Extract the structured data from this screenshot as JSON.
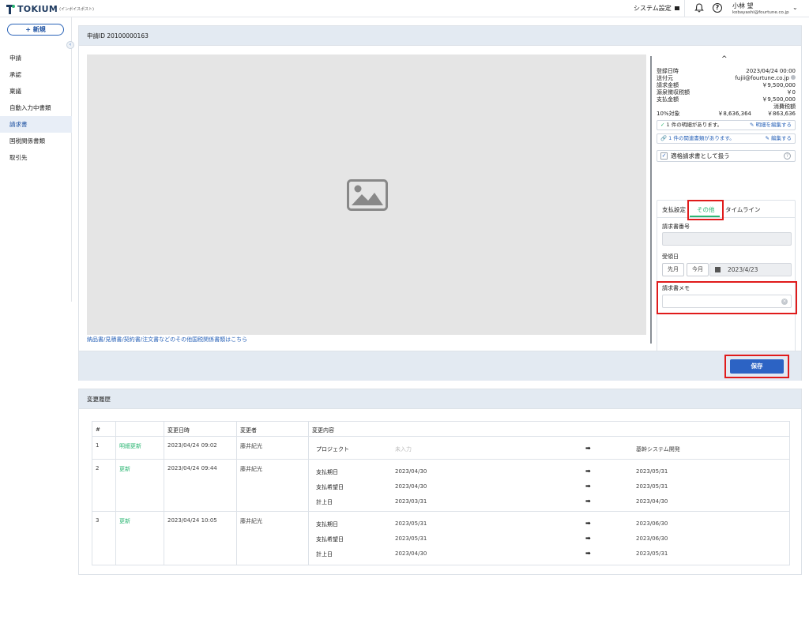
{
  "header": {
    "logo_text": "TOKIUM",
    "logo_sub": "(インボイスポスト)",
    "system_settings": "システム設定",
    "help_glyph": "?",
    "user_name": "小林 望",
    "user_email": "kobayashi@fourtune.co.jp",
    "user_caret": "⌄"
  },
  "sidebar": {
    "new_button": "+ 新規",
    "collapse_glyph": "‹",
    "items": [
      {
        "label": "申請",
        "active": false
      },
      {
        "label": "承認",
        "active": false
      },
      {
        "label": "稟議",
        "active": false
      },
      {
        "label": "自動入力中書類",
        "active": false
      },
      {
        "label": "請求書",
        "active": true
      },
      {
        "label": "国税関係書類",
        "active": false
      },
      {
        "label": "取引先",
        "active": false
      }
    ]
  },
  "main": {
    "request_id": "申請ID 20100000163",
    "other_docs_link": "納品書/見積書/契約書/注文書などのその他国税関係書類はこちら",
    "save_label": "保存"
  },
  "details": {
    "collapse_caret": "^",
    "rows": [
      {
        "key": "登録日時",
        "value": "2023/04/24 00:00"
      },
      {
        "key": "送付元",
        "value": "fujii@fourtune.co.jp"
      },
      {
        "key": "請求金額",
        "value": "￥9,500,000"
      },
      {
        "key": "源泉徴収税額",
        "value": "￥0"
      },
      {
        "key": "支払金額",
        "value": "￥9,500,000"
      }
    ],
    "tax_header": "消費税額",
    "tax_row": {
      "label": "10%対象",
      "base": "￥8,636,364",
      "tax": "￥863,636"
    },
    "line_items": {
      "check": "✓",
      "text": "1 件の明細があります。",
      "link": "明細を編集する"
    },
    "related_docs": {
      "icon": "🔗",
      "text": "1 件の関連書類があります。",
      "link": "編集する"
    },
    "qualified_invoice": {
      "check": "✓",
      "label": "適格請求書として扱う",
      "help": "?"
    }
  },
  "tabs": [
    {
      "label": "支払設定",
      "active": false
    },
    {
      "label": "その他",
      "active": true
    },
    {
      "label": "タイムライン",
      "active": false
    }
  ],
  "form": {
    "invoice_number_label": "請求書番号",
    "invoice_number_value": "",
    "received_date_label": "受領日",
    "prev_month": "先月",
    "this_month": "今月",
    "received_date_value": "2023/4/23",
    "memo_label": "請求書メモ",
    "memo_value": "",
    "clear_glyph": "×"
  },
  "history": {
    "title": "変更履歴",
    "columns": [
      "#",
      "",
      "変更日時",
      "変更者",
      "変更内容"
    ],
    "arrow": "➡",
    "entries": [
      {
        "no": "1",
        "type": "明細更新",
        "datetime": "2023/04/24 09:02",
        "user": "藤井紀光",
        "changes": [
          {
            "field": "プロジェクト",
            "before": "未入力",
            "after": "基幹システム開発"
          }
        ]
      },
      {
        "no": "2",
        "type": "更新",
        "datetime": "2023/04/24 09:44",
        "user": "藤井紀光",
        "changes": [
          {
            "field": "支払期日",
            "before": "2023/04/30",
            "after": "2023/05/31"
          },
          {
            "field": "支払希望日",
            "before": "2023/04/30",
            "after": "2023/05/31"
          },
          {
            "field": "計上日",
            "before": "2023/03/31",
            "after": "2023/04/30"
          }
        ]
      },
      {
        "no": "3",
        "type": "更新",
        "datetime": "2023/04/24 10:05",
        "user": "藤井紀光",
        "changes": [
          {
            "field": "支払期日",
            "before": "2023/05/31",
            "after": "2023/06/30"
          },
          {
            "field": "支払希望日",
            "before": "2023/05/31",
            "after": "2023/06/30"
          },
          {
            "field": "計上日",
            "before": "2023/04/30",
            "after": "2023/05/31"
          }
        ]
      }
    ]
  },
  "colors": {
    "accent_blue": "#2c63c4",
    "accent_green": "#2bb673",
    "highlight_red": "#e01b1b",
    "header_bg": "#e3eaf2"
  }
}
